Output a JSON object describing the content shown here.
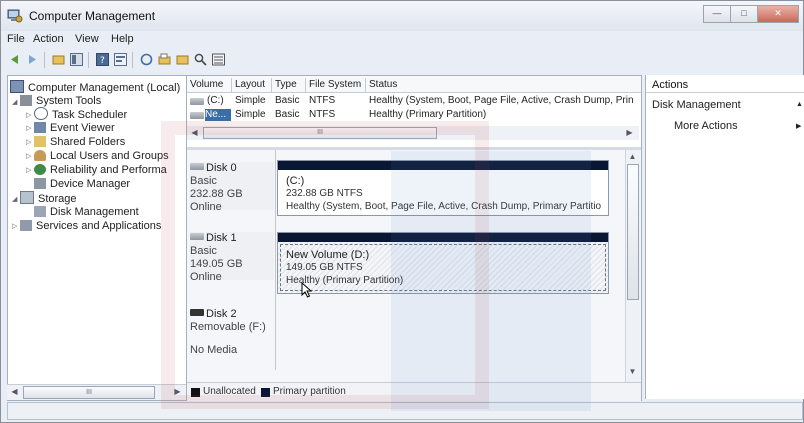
{
  "window": {
    "title": "Computer Management"
  },
  "menu": [
    "File",
    "Action",
    "View",
    "Help"
  ],
  "tree": [
    {
      "label": "Computer Management (Local)",
      "level": 0
    },
    {
      "label": "System Tools",
      "level": 1
    },
    {
      "label": "Task Scheduler",
      "level": 2
    },
    {
      "label": "Event Viewer",
      "level": 2
    },
    {
      "label": "Shared Folders",
      "level": 2
    },
    {
      "label": "Local Users and Groups",
      "level": 2
    },
    {
      "label": "Reliability and Performa",
      "level": 2
    },
    {
      "label": "Device Manager",
      "level": 2
    },
    {
      "label": "Storage",
      "level": 1
    },
    {
      "label": "Disk Management",
      "level": 2
    },
    {
      "label": "Services and Applications",
      "level": 1
    }
  ],
  "left_scroll_thumb": "III",
  "volume_table": {
    "columns": [
      "Volume",
      "Layout",
      "Type",
      "File System",
      "Status"
    ],
    "rows": [
      [
        "(C:)",
        "Simple",
        "Basic",
        "NTFS",
        "Healthy (System, Boot, Page File, Active, Crash Dump, Prin"
      ],
      [
        "Ne...",
        "Simple",
        "Basic",
        "NTFS",
        "Healthy (Primary Partition)"
      ]
    ],
    "scroll_thumb": "III"
  },
  "disks": [
    {
      "name": "Disk 0",
      "kind": "Basic",
      "size": "232.88 GB",
      "state": "Online",
      "partition": {
        "name": "(C:)",
        "detail": "232.88 GB NTFS",
        "status": "Healthy (System, Boot, Page File, Active, Crash Dump, Primary Partitio"
      }
    },
    {
      "name": "Disk 1",
      "kind": "Basic",
      "size": "149.05 GB",
      "state": "Online",
      "partition": {
        "name": "New Volume  (D:)",
        "detail": "149.05 GB NTFS",
        "status": "Healthy (Primary Partition)"
      }
    },
    {
      "name": "Disk 2",
      "kind": "Removable (F:)",
      "state": "No Media"
    }
  ],
  "legend": [
    "Unallocated",
    "Primary partition"
  ],
  "actions": {
    "header": "Actions",
    "section": "Disk Management",
    "more": "More Actions"
  },
  "colors": {
    "partition_bar": "#0a1734",
    "selection": "#3a6ea5",
    "window_bg": "#e9eef6"
  }
}
